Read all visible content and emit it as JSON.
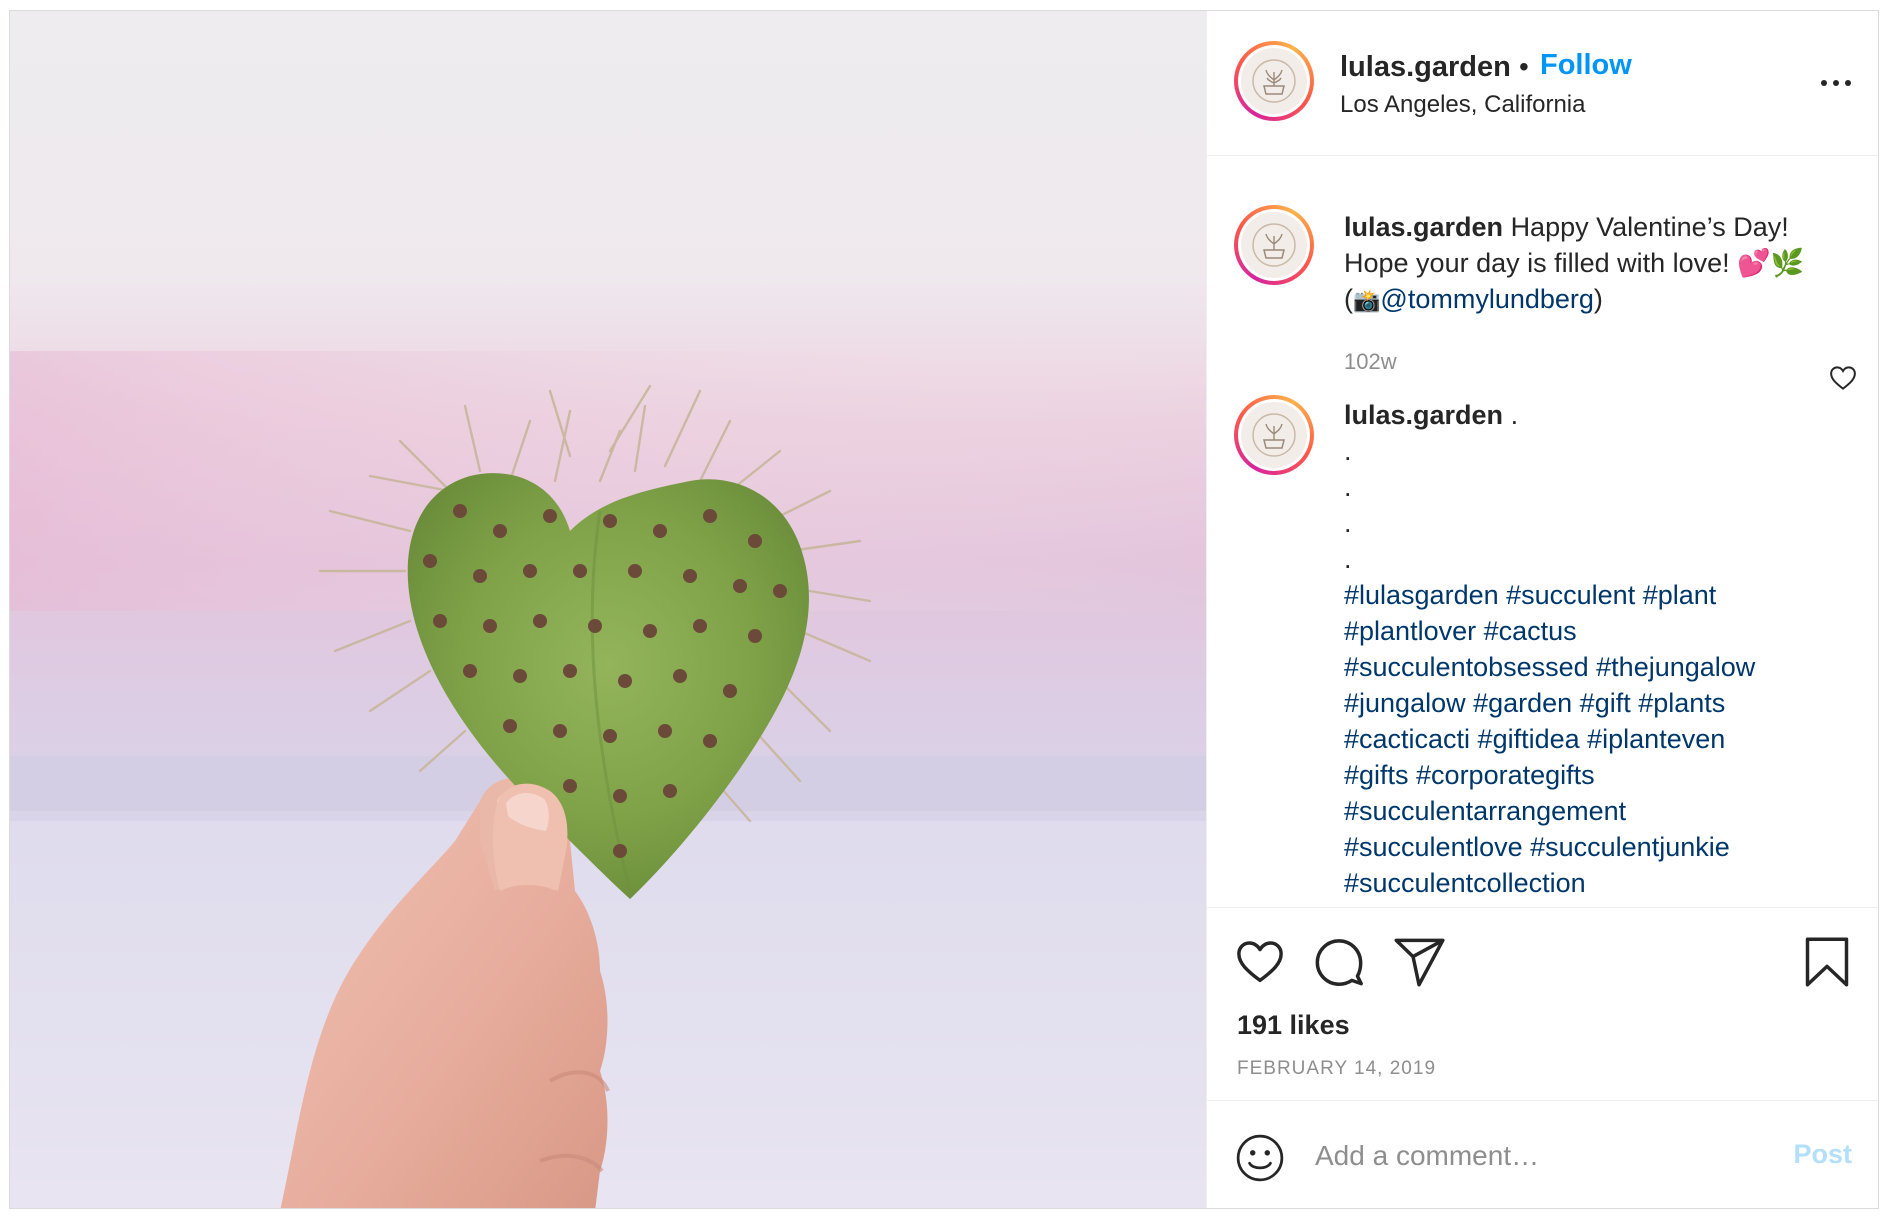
{
  "post": {
    "username": "lulas.garden",
    "follow_label": "Follow",
    "separator": "•",
    "location": "Los Angeles, California",
    "caption": {
      "username": "lulas.garden",
      "line1": "Happy Valentine’s Day!",
      "line2": "Hope your day is filled with love! 💕🌿",
      "line3_open": "(",
      "line3_icon": "📸",
      "mention": "@tommylundberg",
      "line3_close": ")",
      "time_ago": "102w"
    },
    "hashtag_comment": {
      "username": "lulas.garden",
      "first_text": ".",
      "dot_lines": [
        ".",
        ".",
        ".",
        "."
      ],
      "hashtag_lines": [
        "#lulasgarden #succulent #plant",
        "#plantlover #cactus",
        "#succulentobsessed #thejungalow",
        "#jungalow #garden #gift #plants",
        "#cacticacti #giftidea #iplanteven",
        "#gifts #corporategifts",
        "#succulentarrangement",
        "#succulentlove #succulentjunkie",
        "#succulentcollection"
      ]
    },
    "likes": "191 likes",
    "date": "FEBRUARY 14, 2019",
    "add_comment_placeholder": "Add a comment…",
    "post_label": "Post"
  },
  "icons": {
    "more": "more-options-icon",
    "like": "heart-icon",
    "comment": "comment-icon",
    "share": "send-icon",
    "save": "bookmark-icon",
    "emoji": "emoji-icon",
    "comment_like": "small-heart-icon"
  },
  "colors": {
    "accent": "#0095f6",
    "hashtag": "#00376b",
    "muted": "#8e8e8e",
    "post_disabled": "#b2dffc",
    "text": "#262626"
  }
}
